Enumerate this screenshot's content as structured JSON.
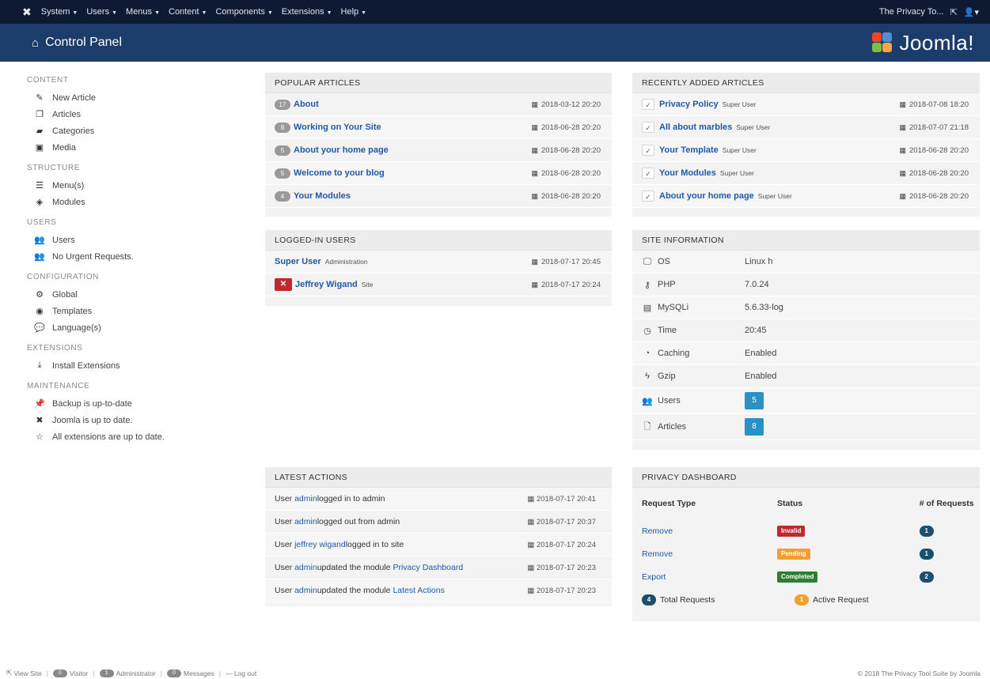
{
  "topbar": {
    "logo_icon": "joomla-icon",
    "menus": [
      "System",
      "Users",
      "Menus",
      "Content",
      "Components",
      "Extensions",
      "Help"
    ],
    "site_name": "The Privacy To...",
    "external_icon": "external-link-icon",
    "user_icon": "user-icon"
  },
  "header": {
    "title": "Control Panel",
    "home_icon": "home-icon",
    "brand_text": "Joomla!",
    "brand_colors": [
      "#f44321",
      "#5091cd",
      "#f9a541",
      "#7ac143"
    ]
  },
  "sidebar": {
    "sections": [
      {
        "title": "CONTENT",
        "items": [
          {
            "label": "New Article",
            "icon": "pencil-icon"
          },
          {
            "label": "Articles",
            "icon": "copy-icon"
          },
          {
            "label": "Categories",
            "icon": "folder-icon"
          },
          {
            "label": "Media",
            "icon": "image-icon"
          }
        ]
      },
      {
        "title": "STRUCTURE",
        "items": [
          {
            "label": "Menu(s)",
            "icon": "list-icon"
          },
          {
            "label": "Modules",
            "icon": "cube-icon"
          }
        ]
      },
      {
        "title": "USERS",
        "items": [
          {
            "label": "Users",
            "icon": "users-icon"
          },
          {
            "label": "No Urgent Requests.",
            "icon": "users-icon"
          }
        ]
      },
      {
        "title": "CONFIGURATION",
        "items": [
          {
            "label": "Global",
            "icon": "cog-icon"
          },
          {
            "label": "Templates",
            "icon": "eye-icon"
          },
          {
            "label": "Language(s)",
            "icon": "comments-icon"
          }
        ]
      },
      {
        "title": "EXTENSIONS",
        "items": [
          {
            "label": "Install Extensions",
            "icon": "download-icon"
          }
        ]
      },
      {
        "title": "MAINTENANCE",
        "items": [
          {
            "label": "Backup is up-to-date",
            "icon": "pin-icon"
          },
          {
            "label": "Joomla is up to date.",
            "icon": "joomla-icon"
          },
          {
            "label": "All extensions are up to date.",
            "icon": "star-icon"
          }
        ]
      }
    ]
  },
  "popular": {
    "title": "POPULAR ARTICLES",
    "rows": [
      {
        "hits": "17",
        "title": "About",
        "date": "2018-03-12 20:20"
      },
      {
        "hits": "8",
        "title": "Working on Your Site",
        "date": "2018-06-28 20:20"
      },
      {
        "hits": "5",
        "title": "About your home page",
        "date": "2018-06-28 20:20"
      },
      {
        "hits": "5",
        "title": "Welcome to your blog",
        "date": "2018-06-28 20:20"
      },
      {
        "hits": "4",
        "title": "Your Modules",
        "date": "2018-06-28 20:20"
      }
    ]
  },
  "recent": {
    "title": "RECENTLY ADDED ARTICLES",
    "rows": [
      {
        "title": "Privacy Policy",
        "author": "Super User",
        "date": "2018-07-08 18:20"
      },
      {
        "title": "All about marbles",
        "author": "Super User",
        "date": "2018-07-07 21:18"
      },
      {
        "title": "Your Template",
        "author": "Super User",
        "date": "2018-06-28 20:20"
      },
      {
        "title": "Your Modules",
        "author": "Super User",
        "date": "2018-06-28 20:20"
      },
      {
        "title": "About your home page",
        "author": "Super User",
        "date": "2018-06-28 20:20"
      }
    ]
  },
  "logged": {
    "title": "LOGGED-IN USERS",
    "rows": [
      {
        "name": "Super User",
        "role": "Administration",
        "date": "2018-07-17 20:45",
        "logout": false
      },
      {
        "name": "Jeffrey Wigand",
        "role": "Site",
        "date": "2018-07-17 20:24",
        "logout": true
      }
    ]
  },
  "siteinfo": {
    "title": "SITE INFORMATION",
    "rows": [
      {
        "key": "OS",
        "icon": "monitor-icon",
        "value": "Linux h"
      },
      {
        "key": "PHP",
        "icon": "key-icon",
        "value": "7.0.24"
      },
      {
        "key": "MySQLi",
        "icon": "database-icon",
        "value": "5.6.33-log"
      },
      {
        "key": "Time",
        "icon": "clock-icon",
        "value": "20:45"
      },
      {
        "key": "Caching",
        "icon": "dashboard-icon",
        "value": "Enabled"
      },
      {
        "key": "Gzip",
        "icon": "flash-icon",
        "value": "Enabled"
      },
      {
        "key": "Users",
        "icon": "users-icon",
        "count": "5"
      },
      {
        "key": "Articles",
        "icon": "file-icon",
        "count": "8"
      }
    ]
  },
  "actions": {
    "title": "LATEST ACTIONS",
    "rows": [
      {
        "pre": "User ",
        "user": "admin",
        "mid": " logged in to admin",
        "link": "",
        "date": "2018-07-17 20:41"
      },
      {
        "pre": "User ",
        "user": "admin",
        "mid": " logged out from admin",
        "link": "",
        "date": "2018-07-17 20:37"
      },
      {
        "pre": "User ",
        "user": "jeffrey wigand",
        "mid": " logged in to site",
        "link": "",
        "date": "2018-07-17 20:24"
      },
      {
        "pre": "User ",
        "user": "admin",
        "mid": " updated the module ",
        "link": "Privacy Dashboard",
        "date": "2018-07-17 20:23"
      },
      {
        "pre": "User ",
        "user": "admin",
        "mid": " updated the module ",
        "link": "Latest Actions",
        "date": "2018-07-17 20:23"
      }
    ]
  },
  "privacy": {
    "title": "PRIVACY DASHBOARD",
    "headers": [
      "Request Type",
      "Status",
      "# of Requests"
    ],
    "rows": [
      {
        "type": "Remove",
        "status": "Invalid",
        "status_color": "#c0282d",
        "count": "1"
      },
      {
        "type": "Remove",
        "status": "Pending",
        "status_color": "#f0a030",
        "count": "1"
      },
      {
        "type": "Export",
        "status": "Completed",
        "status_color": "#2f7d33",
        "count": "2"
      }
    ],
    "total_count": "4",
    "total_label": "Total Requests",
    "active_count": "1",
    "active_label": "Active Request"
  },
  "footer": {
    "view_site": "View Site",
    "visitors_count": "0",
    "visitors": "Visitor",
    "admins_count": "1",
    "admins": "Administrator",
    "messages_count": "0",
    "messages": "Messages",
    "logout": "Log out",
    "copyright": "© 2018 The Privacy Tool Suite by Joomla"
  },
  "colors": {
    "topbar": "#0e1a31",
    "header": "#1c3d6b",
    "link": "#1f5aa6",
    "count_box": "#2b91c2"
  }
}
